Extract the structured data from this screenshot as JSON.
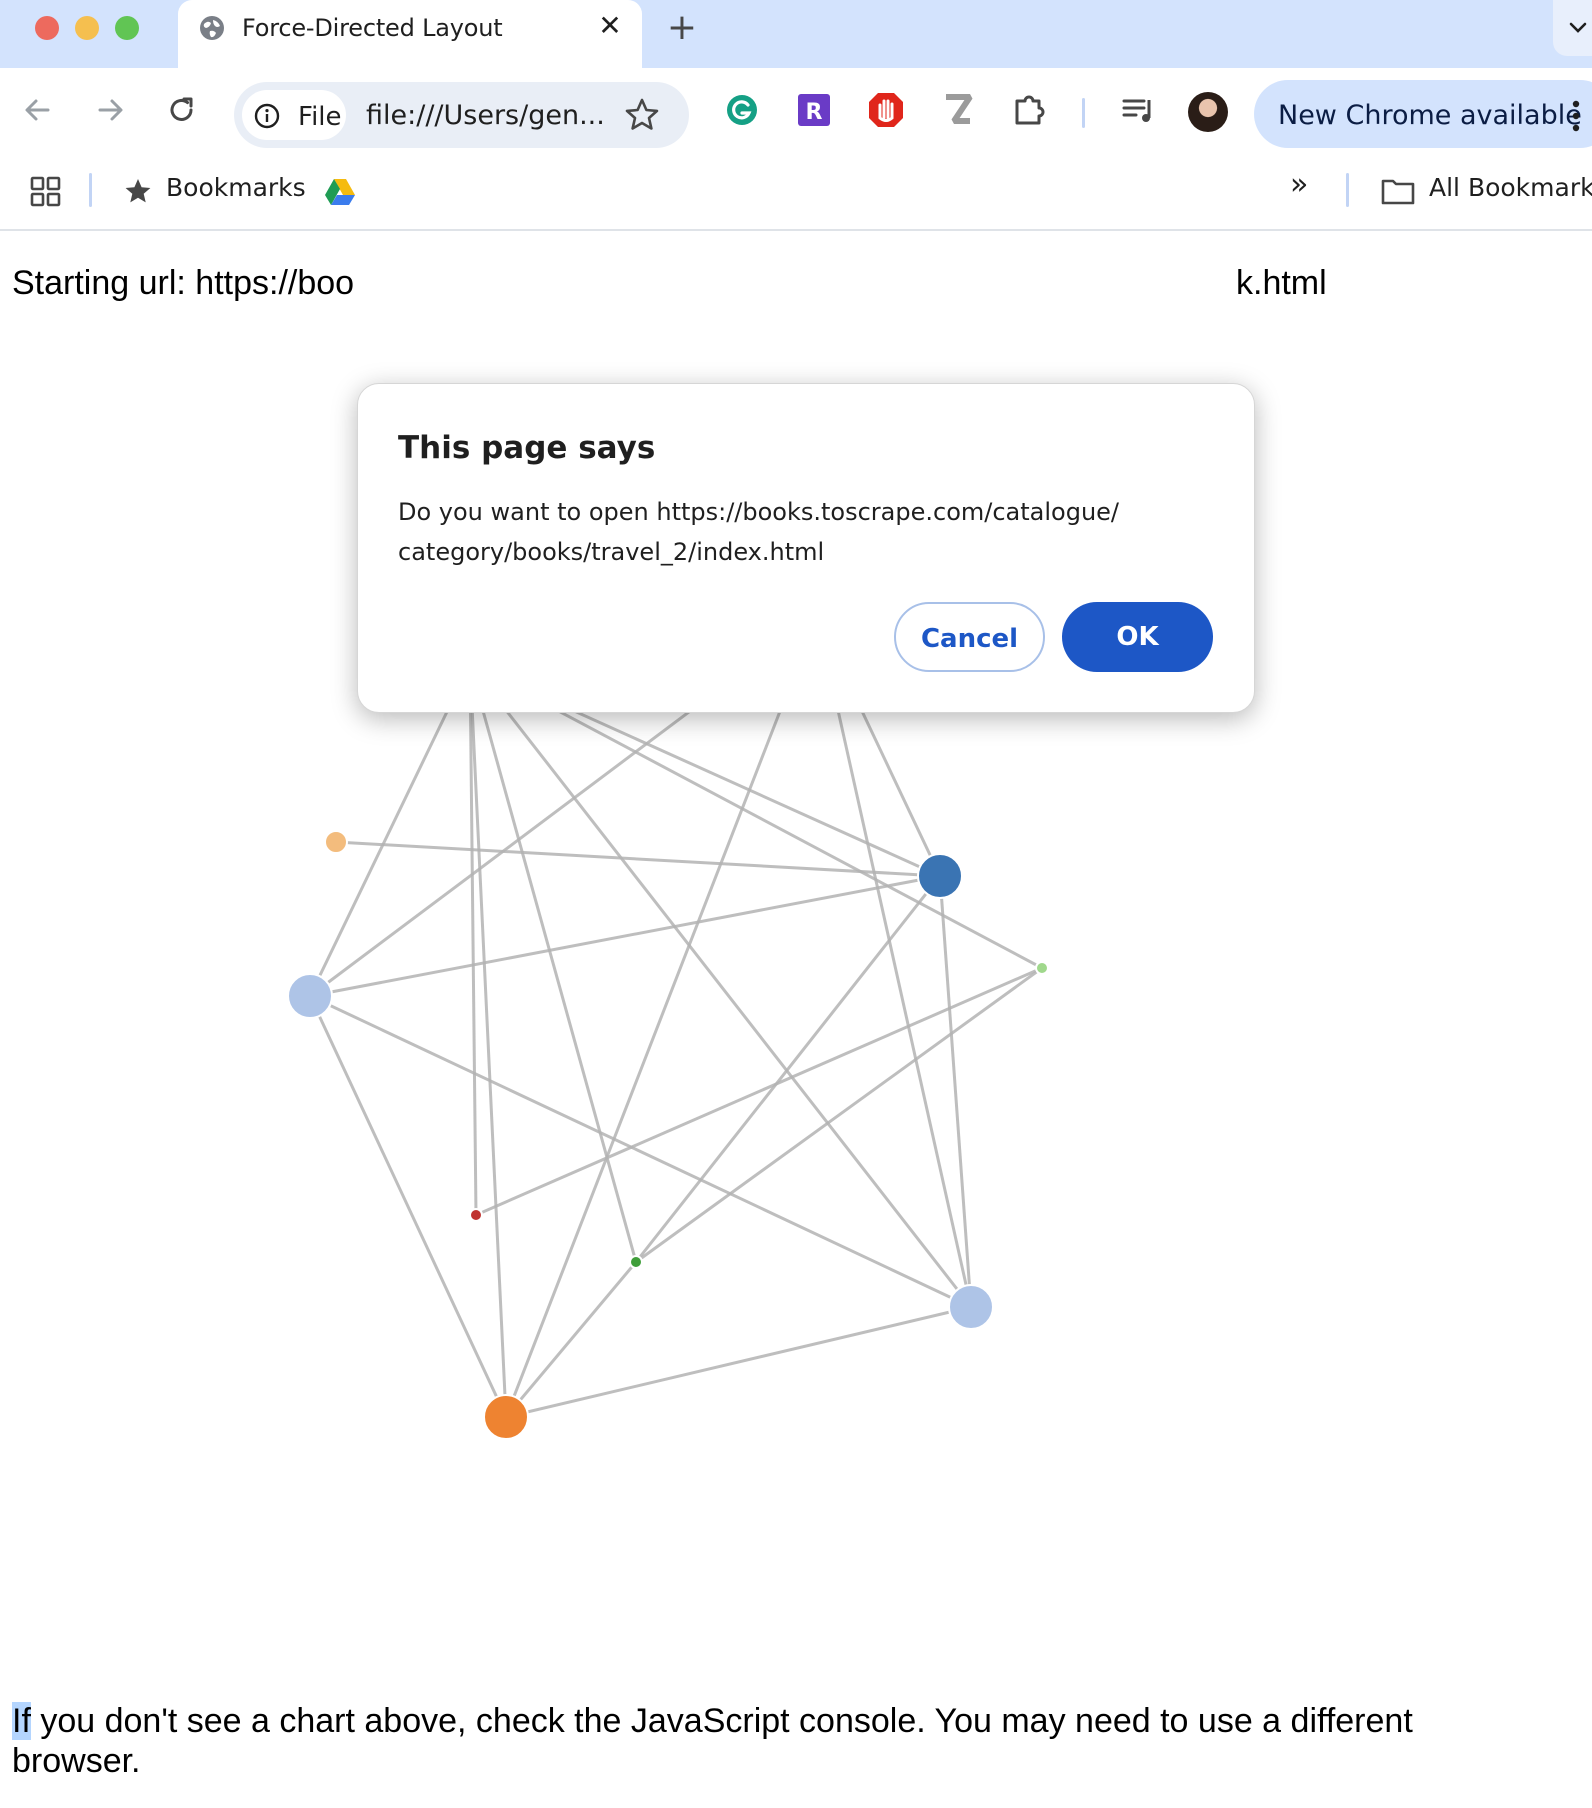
{
  "browser": {
    "tab": {
      "title": "Force-Directed Layout",
      "close_glyph": "✕"
    },
    "new_tab_glyph": "+",
    "omnibox": {
      "site_chip_label": "File",
      "url": "file:///Users/gen..."
    },
    "update_label": "New Chrome available",
    "bookmarks": {
      "bookmarks_label": "Bookmarks",
      "overflow_glyph": "»",
      "all_bookmarks_label": "All Bookmarks"
    },
    "icons": [
      "globe-icon",
      "back-arrow-icon",
      "forward-arrow-icon",
      "reload-icon",
      "info-icon",
      "star-icon",
      "grammarly-icon",
      "r-extension-icon",
      "adblock-hand-icon",
      "z-extension-icon",
      "puzzle-extensions-icon",
      "media-control-icon",
      "kebab-menu-icon",
      "apps-grid-icon",
      "google-drive-icon",
      "folder-icon",
      "chevron-down-icon"
    ]
  },
  "page": {
    "starting_url": "Starting url: https://boo",
    "starting_url_tail": "k.html",
    "footer_selected": "If",
    "footer_rest": " you don't see a chart above, check the JavaScript console. You may need to use a different browser."
  },
  "dialog": {
    "title": "This page says",
    "message_line1": "Do you want to open https://books.toscrape.com/catalogue/",
    "message_line2": "category/books/travel_2/index.html",
    "cancel_label": "Cancel",
    "ok_label": "OK"
  },
  "graph": {
    "type": "force-directed",
    "colors": {
      "link": "#b3b3b3",
      "node_stroke": "#ffffff"
    },
    "nodes": [
      {
        "id": "n0",
        "color": "#f2a19a",
        "size": "small"
      },
      {
        "id": "n1",
        "color": "#c0322f",
        "size": "small"
      },
      {
        "id": "n2",
        "color": "#f3bc7d",
        "size": "medium"
      },
      {
        "id": "n3",
        "color": "#3a74b3",
        "size": "large"
      },
      {
        "id": "n4",
        "color": "#a0d88c",
        "size": "small"
      },
      {
        "id": "n5",
        "color": "#aec4e7",
        "size": "large"
      },
      {
        "id": "n6",
        "color": "#c0322f",
        "size": "small"
      },
      {
        "id": "n7",
        "color": "#3f9e3a",
        "size": "small"
      },
      {
        "id": "n8",
        "color": "#aec4e7",
        "size": "large"
      },
      {
        "id": "n9",
        "color": "#ee8331",
        "size": "large"
      }
    ],
    "links": [
      [
        "n0",
        "n1"
      ],
      [
        "n0",
        "n5"
      ],
      [
        "n0",
        "n3"
      ],
      [
        "n0",
        "n4"
      ],
      [
        "n0",
        "n6"
      ],
      [
        "n0",
        "n9"
      ],
      [
        "n0",
        "n7"
      ],
      [
        "n0",
        "n8"
      ],
      [
        "n1",
        "n3"
      ],
      [
        "n1",
        "n5"
      ],
      [
        "n1",
        "n9"
      ],
      [
        "n1",
        "n8"
      ],
      [
        "n2",
        "n3"
      ],
      [
        "n3",
        "n5"
      ],
      [
        "n3",
        "n7"
      ],
      [
        "n3",
        "n8"
      ],
      [
        "n4",
        "n6"
      ],
      [
        "n4",
        "n7"
      ],
      [
        "n5",
        "n8"
      ],
      [
        "n5",
        "n9"
      ],
      [
        "n7",
        "n9"
      ],
      [
        "n8",
        "n9"
      ]
    ]
  }
}
